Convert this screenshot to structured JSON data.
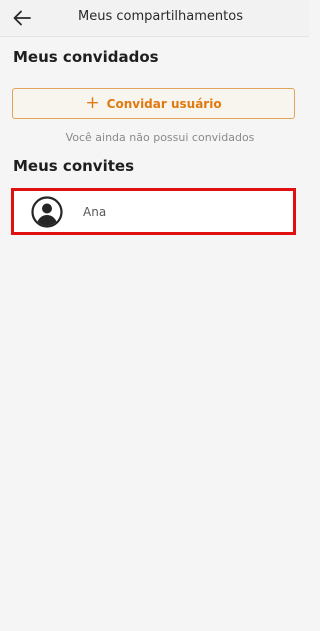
{
  "header": {
    "title": "Meus compartilhamentos",
    "back_icon": "arrow-left-icon"
  },
  "guests": {
    "title": "Meus convidados",
    "invite_button_label": "Convidar usuário",
    "invite_icon": "plus-icon",
    "empty_message": "Você ainda não possui convidados"
  },
  "invites": {
    "title": "Meus convites",
    "items": [
      {
        "name": "Ana",
        "icon": "user-circle-icon"
      }
    ]
  },
  "colors": {
    "accent": "#e07a10",
    "highlight_border": "#e01010"
  }
}
